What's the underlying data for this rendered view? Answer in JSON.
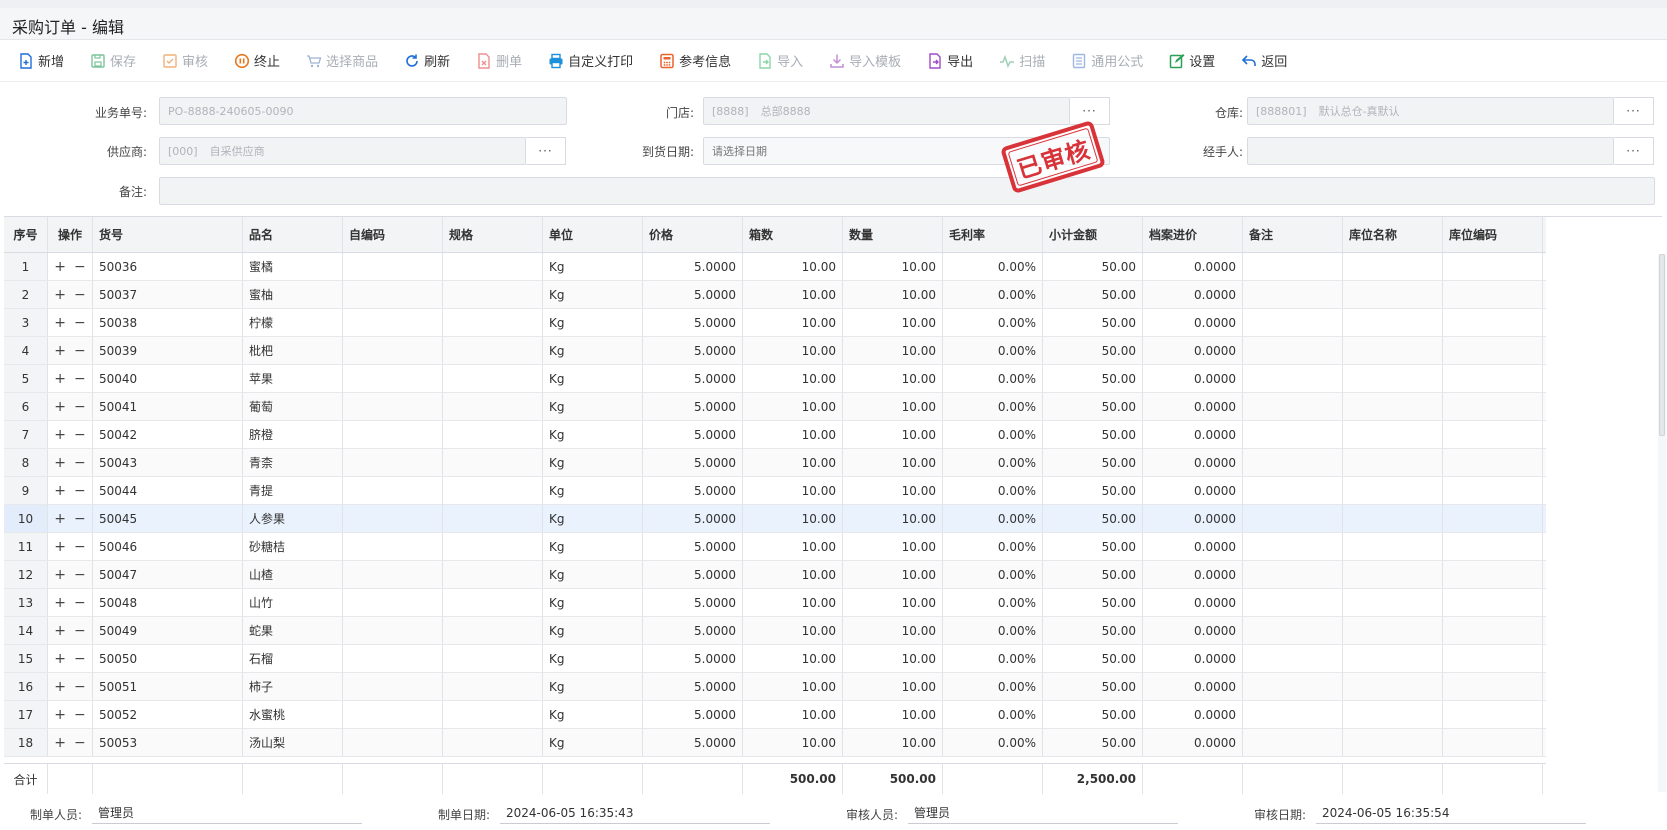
{
  "title": "采购订单 - 编辑",
  "toolbar": {
    "add": "新增",
    "save": "保存",
    "audit": "审核",
    "stop": "终止",
    "select_goods": "选择商品",
    "refresh": "刷新",
    "delete_order": "删单",
    "custom_print": "自定义打印",
    "reference_info": "参考信息",
    "import": "导入",
    "import_template": "导入模板",
    "export": "导出",
    "scan": "扫描",
    "formula": "通用公式",
    "settings": "设置",
    "back": "返回"
  },
  "form": {
    "order_no_label": "业务单号:",
    "order_no_value": "PO-8888-240605-0090",
    "store_label": "门店:",
    "store_code": "[8888]",
    "store_name": "总部8888",
    "warehouse_label": "仓库:",
    "warehouse_code": "[888801]",
    "warehouse_name": "默认总仓-真默认",
    "supplier_label": "供应商:",
    "supplier_code": "[000]",
    "supplier_name": "自采供应商",
    "arrival_label": "到货日期:",
    "arrival_placeholder": "请选择日期",
    "handler_label": "经手人:",
    "handler_value": "",
    "remark_label": "备注:",
    "remark_value": "",
    "more": "···"
  },
  "stamp": "已审核",
  "grid": {
    "headers": [
      "序号",
      "操作",
      "货号",
      "品名",
      "自编码",
      "规格",
      "单位",
      "价格",
      "箱数",
      "数量",
      "毛利率",
      "小计金额",
      "档案进价",
      "备注",
      "库位名称",
      "库位编码"
    ],
    "rows": [
      {
        "seq": "1",
        "code": "50036",
        "name": "蜜橘",
        "unit": "Kg",
        "price": "5.0000",
        "boxes": "10.00",
        "qty": "10.00",
        "rate": "0.00%",
        "subtotal": "50.00",
        "arch": "0.0000"
      },
      {
        "seq": "2",
        "code": "50037",
        "name": "蜜柚",
        "unit": "Kg",
        "price": "5.0000",
        "boxes": "10.00",
        "qty": "10.00",
        "rate": "0.00%",
        "subtotal": "50.00",
        "arch": "0.0000"
      },
      {
        "seq": "3",
        "code": "50038",
        "name": "柠檬",
        "unit": "Kg",
        "price": "5.0000",
        "boxes": "10.00",
        "qty": "10.00",
        "rate": "0.00%",
        "subtotal": "50.00",
        "arch": "0.0000"
      },
      {
        "seq": "4",
        "code": "50039",
        "name": "枇杷",
        "unit": "Kg",
        "price": "5.0000",
        "boxes": "10.00",
        "qty": "10.00",
        "rate": "0.00%",
        "subtotal": "50.00",
        "arch": "0.0000"
      },
      {
        "seq": "5",
        "code": "50040",
        "name": "苹果",
        "unit": "Kg",
        "price": "5.0000",
        "boxes": "10.00",
        "qty": "10.00",
        "rate": "0.00%",
        "subtotal": "50.00",
        "arch": "0.0000"
      },
      {
        "seq": "6",
        "code": "50041",
        "name": "葡萄",
        "unit": "Kg",
        "price": "5.0000",
        "boxes": "10.00",
        "qty": "10.00",
        "rate": "0.00%",
        "subtotal": "50.00",
        "arch": "0.0000"
      },
      {
        "seq": "7",
        "code": "50042",
        "name": "脐橙",
        "unit": "Kg",
        "price": "5.0000",
        "boxes": "10.00",
        "qty": "10.00",
        "rate": "0.00%",
        "subtotal": "50.00",
        "arch": "0.0000"
      },
      {
        "seq": "8",
        "code": "50043",
        "name": "青柰",
        "unit": "Kg",
        "price": "5.0000",
        "boxes": "10.00",
        "qty": "10.00",
        "rate": "0.00%",
        "subtotal": "50.00",
        "arch": "0.0000"
      },
      {
        "seq": "9",
        "code": "50044",
        "name": "青提",
        "unit": "Kg",
        "price": "5.0000",
        "boxes": "10.00",
        "qty": "10.00",
        "rate": "0.00%",
        "subtotal": "50.00",
        "arch": "0.0000"
      },
      {
        "seq": "10",
        "code": "50045",
        "name": "人参果",
        "unit": "Kg",
        "price": "5.0000",
        "boxes": "10.00",
        "qty": "10.00",
        "rate": "0.00%",
        "subtotal": "50.00",
        "arch": "0.0000"
      },
      {
        "seq": "11",
        "code": "50046",
        "name": "砂糖桔",
        "unit": "Kg",
        "price": "5.0000",
        "boxes": "10.00",
        "qty": "10.00",
        "rate": "0.00%",
        "subtotal": "50.00",
        "arch": "0.0000"
      },
      {
        "seq": "12",
        "code": "50047",
        "name": "山楂",
        "unit": "Kg",
        "price": "5.0000",
        "boxes": "10.00",
        "qty": "10.00",
        "rate": "0.00%",
        "subtotal": "50.00",
        "arch": "0.0000"
      },
      {
        "seq": "13",
        "code": "50048",
        "name": "山竹",
        "unit": "Kg",
        "price": "5.0000",
        "boxes": "10.00",
        "qty": "10.00",
        "rate": "0.00%",
        "subtotal": "50.00",
        "arch": "0.0000"
      },
      {
        "seq": "14",
        "code": "50049",
        "name": "蛇果",
        "unit": "Kg",
        "price": "5.0000",
        "boxes": "10.00",
        "qty": "10.00",
        "rate": "0.00%",
        "subtotal": "50.00",
        "arch": "0.0000"
      },
      {
        "seq": "15",
        "code": "50050",
        "name": "石榴",
        "unit": "Kg",
        "price": "5.0000",
        "boxes": "10.00",
        "qty": "10.00",
        "rate": "0.00%",
        "subtotal": "50.00",
        "arch": "0.0000"
      },
      {
        "seq": "16",
        "code": "50051",
        "name": "柿子",
        "unit": "Kg",
        "price": "5.0000",
        "boxes": "10.00",
        "qty": "10.00",
        "rate": "0.00%",
        "subtotal": "50.00",
        "arch": "0.0000"
      },
      {
        "seq": "17",
        "code": "50052",
        "name": "水蜜桃",
        "unit": "Kg",
        "price": "5.0000",
        "boxes": "10.00",
        "qty": "10.00",
        "rate": "0.00%",
        "subtotal": "50.00",
        "arch": "0.0000"
      },
      {
        "seq": "18",
        "code": "50053",
        "name": "汤山梨",
        "unit": "Kg",
        "price": "5.0000",
        "boxes": "10.00",
        "qty": "10.00",
        "rate": "0.00%",
        "subtotal": "50.00",
        "arch": "0.0000"
      }
    ],
    "selected_row": 9,
    "op_add": "+",
    "op_remove": "−",
    "total_label": "合计",
    "total_boxes": "500.00",
    "total_qty": "500.00",
    "total_subtotal": "2,500.00"
  },
  "footer": {
    "creator_label": "制单人员:",
    "creator": "管理员",
    "created_label": "制单日期:",
    "created": "2024-06-05 16:35:43",
    "auditor_label": "审核人员:",
    "auditor": "管理员",
    "audited_label": "审核日期:",
    "audited": "2024-06-05 16:35:54"
  },
  "colors": {
    "accent": "#1e6fd9",
    "stamp": "#d9333a",
    "selected_row": "#eaf2fd"
  }
}
